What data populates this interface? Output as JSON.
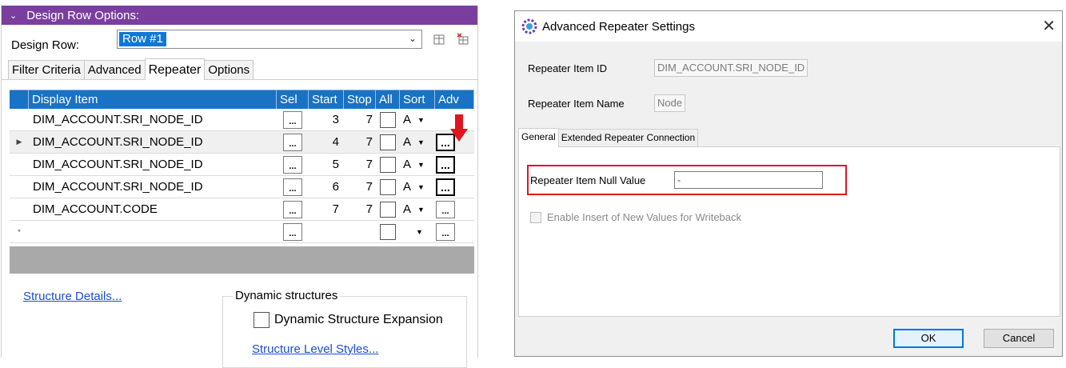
{
  "left_panel": {
    "header_title": "Design Row Options:",
    "design_row_label": "Design Row:",
    "design_row_value": "Row #1",
    "tabs": [
      {
        "label": "Filter Criteria"
      },
      {
        "label": "Advanced"
      },
      {
        "label": "Repeater"
      },
      {
        "label": "Options"
      }
    ],
    "grid": {
      "columns": [
        "Display Item",
        "Sel",
        "Start",
        "Stop",
        "All",
        "Sort",
        "Adv"
      ],
      "rows": [
        {
          "item": "DIM_ACCOUNT.SRI_NODE_ID",
          "sel": "...",
          "start": "3",
          "stop": "7",
          "sort": "A",
          "adv": "..."
        },
        {
          "item": "DIM_ACCOUNT.SRI_NODE_ID",
          "sel": "...",
          "start": "4",
          "stop": "7",
          "sort": "A",
          "adv": "..."
        },
        {
          "item": "DIM_ACCOUNT.SRI_NODE_ID",
          "sel": "...",
          "start": "5",
          "stop": "7",
          "sort": "A",
          "adv": "..."
        },
        {
          "item": "DIM_ACCOUNT.SRI_NODE_ID",
          "sel": "...",
          "start": "6",
          "stop": "7",
          "sort": "A",
          "adv": "..."
        },
        {
          "item": "DIM_ACCOUNT.CODE",
          "sel": "...",
          "start": "7",
          "stop": "7",
          "sort": "A",
          "adv": "..."
        },
        {
          "item": "",
          "sel": "...",
          "start": "",
          "stop": "",
          "sort": "",
          "adv": "..."
        }
      ],
      "current_row_marker": "▶",
      "new_row_marker": "*"
    },
    "structure_details_link": "Structure Details...",
    "dynamic_structures_title": "Dynamic structures",
    "dynamic_expansion_label": "Dynamic Structure Expansion",
    "structure_level_styles_link": "Structure Level Styles..."
  },
  "dialog": {
    "title": "Advanced Repeater Settings",
    "repeater_item_id_label": "Repeater Item ID",
    "repeater_item_id_value": "DIM_ACCOUNT.SRI_NODE_ID",
    "repeater_item_name_label": "Repeater Item Name",
    "repeater_item_name_value": "Node",
    "tabs": [
      {
        "label": "General"
      },
      {
        "label": "Extended Repeater Connection"
      }
    ],
    "null_value_label": "Repeater Item Null Value",
    "null_value_input": "-",
    "writeback_label": "Enable Insert of New Values for Writeback",
    "ok_label": "OK",
    "cancel_label": "Cancel"
  },
  "colors": {
    "header_purple": "#7a3f9e",
    "grid_header_blue": "#1a72c4",
    "highlight_red": "#e0151e",
    "link_blue": "#1a4fcc"
  }
}
